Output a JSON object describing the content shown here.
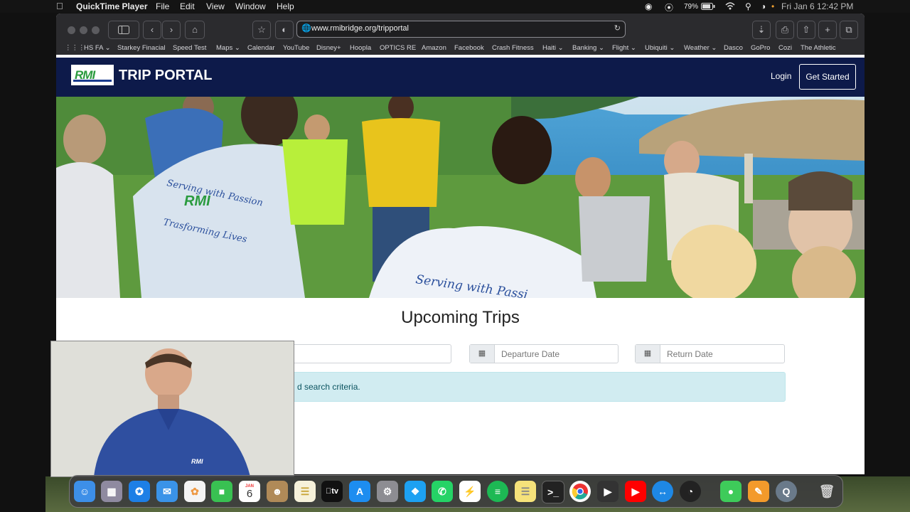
{
  "menubar": {
    "app_name": "QuickTime Player",
    "menus": [
      "File",
      "Edit",
      "View",
      "Window",
      "Help"
    ],
    "battery": "79%",
    "datetime": "Fri Jan 6  12:42 PM"
  },
  "browser": {
    "url": "www.rmibridge.org/tripportal",
    "bookmarks": [
      "HS FA ⌄",
      "Starkey Finacial",
      "Speed Test",
      "Maps ⌄",
      "Calendar",
      "YouTube",
      "Disney+",
      "Hoopla",
      "OPTICS RE",
      "Amazon",
      "Facebook",
      "Crash Fitness",
      "Haiti ⌄",
      "Banking ⌄",
      "Flight ⌄",
      "Ubiquiti ⌄",
      "Weather ⌄",
      "Dasco",
      "GoPro",
      "Cozi",
      "The Athletic"
    ]
  },
  "site": {
    "logo_text": "RMI",
    "brand": "TRIP PORTAL",
    "login": "Login",
    "get_started": "Get Started",
    "shirt_text_1": "Serving with Passion",
    "shirt_text_2": "Trasforming Lives",
    "shirt_logo": "RMI",
    "shirt_text_3": "Serving with Passi"
  },
  "content": {
    "title": "Upcoming Trips",
    "departure_placeholder": "Departure Date",
    "return_placeholder": "Return Date",
    "alert_text": "d search criteria."
  },
  "webcam": {
    "shirt_logo": "RMI"
  },
  "dock": {
    "calendar_month": "JAN",
    "calendar_day": "6",
    "tv_label": "tv"
  },
  "colors": {
    "header_bg": "#0d1a4a",
    "alert_bg": "#d1ecf1",
    "alert_text": "#0c5460"
  }
}
